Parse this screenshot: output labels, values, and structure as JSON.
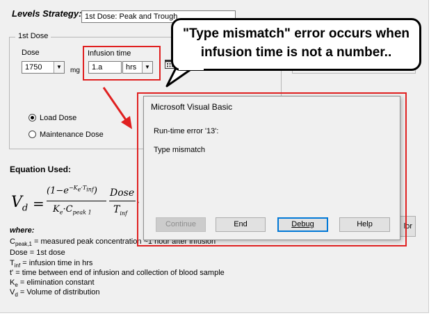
{
  "form": {
    "levels_strategy_label": "Levels Strategy:",
    "levels_strategy_value": "1st Dose: Peak and Trough",
    "dose_group_title": "1st Dose",
    "dose_label": "Dose",
    "dose_value": "1750",
    "dose_unit": "mg",
    "infusion_label": "Infusion time",
    "infusion_value": "1.a",
    "infusion_unit": "hrs",
    "load_dose_label": "Load Dose",
    "maintenance_dose_label": "Maintenance Dose",
    "equation_title": "Equation Used:",
    "partial_button_label": "lor"
  },
  "equation": {
    "lhs": "V",
    "lhs_sub": "d",
    "eq": "=",
    "num_main": "(1−e",
    "num_exp": "−K",
    "num_exp_sub": "e",
    "num_exp_tail": "·T",
    "num_exp_tail_sub": "inf",
    "num_close": ")",
    "den_k": "K",
    "den_k_sub": "e",
    "den_c": "·C",
    "den_c_sub": "peak 1",
    "dose": "Dose",
    "tinf": "T",
    "tinf_sub": "inf",
    "dot": "·"
  },
  "where": {
    "title": "where:",
    "cpeak_sym": "C",
    "cpeak_sub": "peak,1",
    "cpeak_text": " = measured peak concentration ~1 hour after infusion",
    "dose_text": "Dose = 1st dose",
    "tinf_sym": "T",
    "tinf_sub": "inf",
    "tinf_text": " = infusion time in hrs",
    "tprime_text": "t' = time between end of infusion and collection of blood sample",
    "ke_sym": "K",
    "ke_sub": "e",
    "ke_text": " = elimination constant",
    "vd_sym": "V",
    "vd_sub": "d",
    "vd_text": " = Volume of distribution"
  },
  "callout": {
    "line1": "\"Type mismatch\" error occurs when",
    "line2": "infusion time is not a number.."
  },
  "dialog": {
    "title": "Microsoft Visual Basic",
    "error_line": "Run-time error '13':",
    "message": "Type mismatch",
    "buttons": {
      "continue": "Continue",
      "end": "End",
      "debug": "Debug",
      "help": "Help"
    }
  },
  "colors": {
    "annotation_red": "#e02020",
    "form_bg": "#f0f0f0",
    "dialog_bg": "#f0f0f0"
  },
  "icons": {
    "calendar": "calendar-icon",
    "dropdown": "chevron-down-icon"
  }
}
